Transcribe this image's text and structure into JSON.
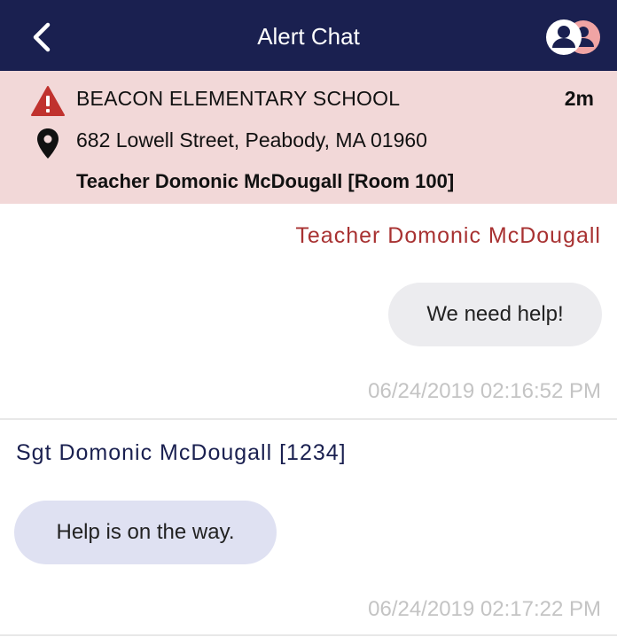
{
  "header": {
    "title": "Alert Chat",
    "back_icon": "chevron-left-icon",
    "participants_icon": "participants-icon",
    "background_color": "#1a2050"
  },
  "alert": {
    "icon": "warning-triangle-icon",
    "school": "BEACON ELEMENTARY SCHOOL",
    "elapsed": "2m",
    "location_icon": "map-pin-icon",
    "address": "682 Lowell Street, Peabody, MA 01960",
    "reporter": "Teacher Domonic McDougall [Room 100]",
    "background_color": "#f2d8d8",
    "warning_color": "#c0322e"
  },
  "messages": [
    {
      "direction": "outgoing",
      "sender": "Teacher Domonic McDougall",
      "text": "We need help!",
      "timestamp": "06/24/2019 02:16:52 PM",
      "sender_color": "#a83232"
    },
    {
      "direction": "incoming",
      "sender": "Sgt Domonic McDougall [1234]",
      "text": "Help is on the way.",
      "timestamp": "06/24/2019 02:17:22 PM",
      "sender_color": "#1a2050"
    }
  ]
}
